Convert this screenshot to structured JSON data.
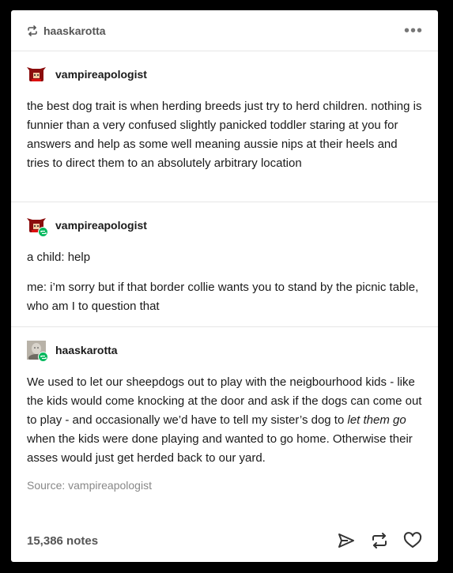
{
  "header": {
    "reblogger": "haaskarotta",
    "more_icon": "ellipsis-icon"
  },
  "posts": [
    {
      "username": "vampireapologist",
      "paragraphs": [
        "the best dog trait is when herding breeds just try to herd children. nothing is funnier than a very confused slightly panicked toddler staring at you for answers and help as some well meaning aussie nips at their heels and tries to direct them to an absolutely arbitrary location"
      ]
    },
    {
      "username": "vampireapologist",
      "paragraphs": [
        "a child: help",
        "me: i’m sorry but if that border collie wants you to stand by the picnic table, who am I to question that"
      ]
    },
    {
      "username": "haaskarotta",
      "paragraphs": [
        "We used to let our sheepdogs out to play with the neigbourhood kids - like the kids would come knocking at the door and ask if the dogs can come out to play - and occasionally we’d have to tell my sister’s dog to ",
        "let them go",
        " when the kids were done playing and wanted to go home. Otherwise their asses would just get herded back to our yard."
      ]
    }
  ],
  "source": {
    "label": "Source: vampireapologist"
  },
  "footer": {
    "notes": "15,386 notes",
    "icons": [
      "share-icon",
      "reblog-icon",
      "like-icon"
    ]
  },
  "colors": {
    "badge": "#00b85c",
    "background": "#000000",
    "card": "#ffffff"
  }
}
